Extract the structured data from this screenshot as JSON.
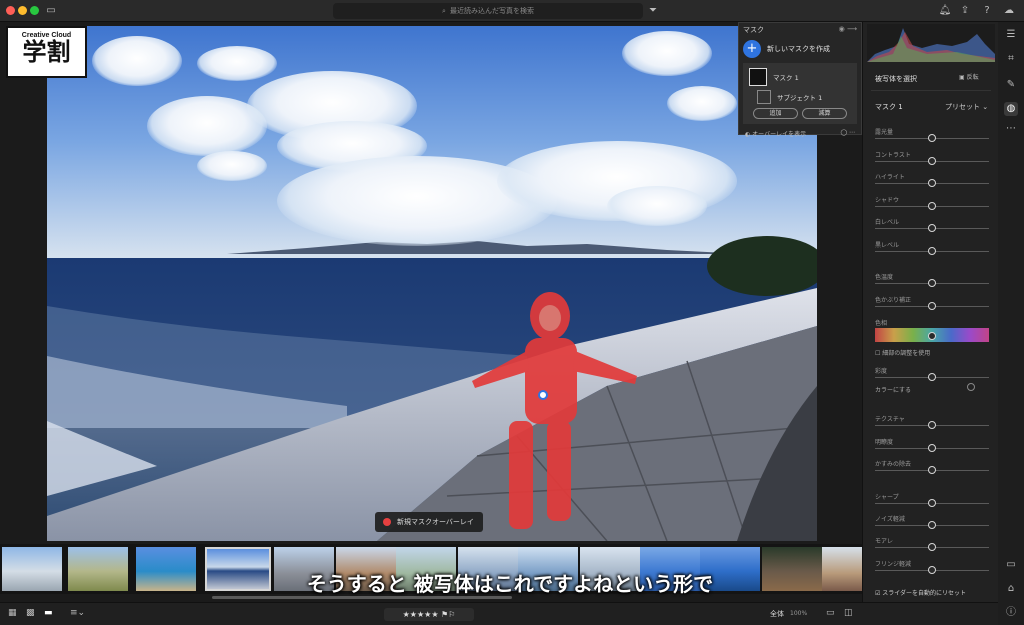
{
  "titlebar": {
    "search_placeholder": "最近読み込んだ写真を検索"
  },
  "logo": {
    "line1": "Creative Cloud",
    "line2": "学割"
  },
  "photo": {
    "overlay_toast": "新規マスクオーバーレイ"
  },
  "mask_panel": {
    "title": "マスク",
    "new_mask": "新しいマスクを作成",
    "masks": [
      {
        "label": "マスク 1"
      },
      {
        "label": "サブジェクト 1"
      }
    ],
    "add_button": "追加",
    "subtract_button": "減算",
    "show_overlay": "オーバーレイを表示"
  },
  "right_panel": {
    "select_subject": "被写体を選択",
    "invert": "反転",
    "mask_name": "マスク 1",
    "preset": "プリセット",
    "sliders": [
      {
        "label": "露光量",
        "value": 0.5
      },
      {
        "label": "コントラスト",
        "value": 0.5
      },
      {
        "label": "ハイライト",
        "value": 0.5
      },
      {
        "label": "シャドウ",
        "value": 0.5
      },
      {
        "label": "白レベル",
        "value": 0.5
      },
      {
        "label": "黒レベル",
        "value": 0.5
      },
      {
        "label": "色温度",
        "value": 0.5
      },
      {
        "label": "色かぶり補正",
        "value": 0.5
      },
      {
        "label": "色相",
        "value": 0.5
      },
      {
        "label": "彩度",
        "value": 0.5
      },
      {
        "label": "テクスチャ",
        "value": 0.5
      },
      {
        "label": "明瞭度",
        "value": 0.5
      },
      {
        "label": "かすみの除去",
        "value": 0.5
      },
      {
        "label": "シャープ",
        "value": 0.5
      },
      {
        "label": "ノイズ軽減",
        "value": 0.5
      },
      {
        "label": "モアレ",
        "value": 0.5
      },
      {
        "label": "フリンジ軽減",
        "value": 0.5
      }
    ],
    "fine_tune": "細部の調整を使用",
    "colorize": "カラーにする",
    "auto_reset": "スライダーを自動的にリセット"
  },
  "subtitle": "そうすると 被写体はこれですよねという形で",
  "bottombar": {
    "stars": "★★★★★",
    "fit": "全体",
    "zoom": "100%"
  },
  "colors": {
    "accent": "#2f74e0",
    "mask_red": "#e23a3a"
  }
}
